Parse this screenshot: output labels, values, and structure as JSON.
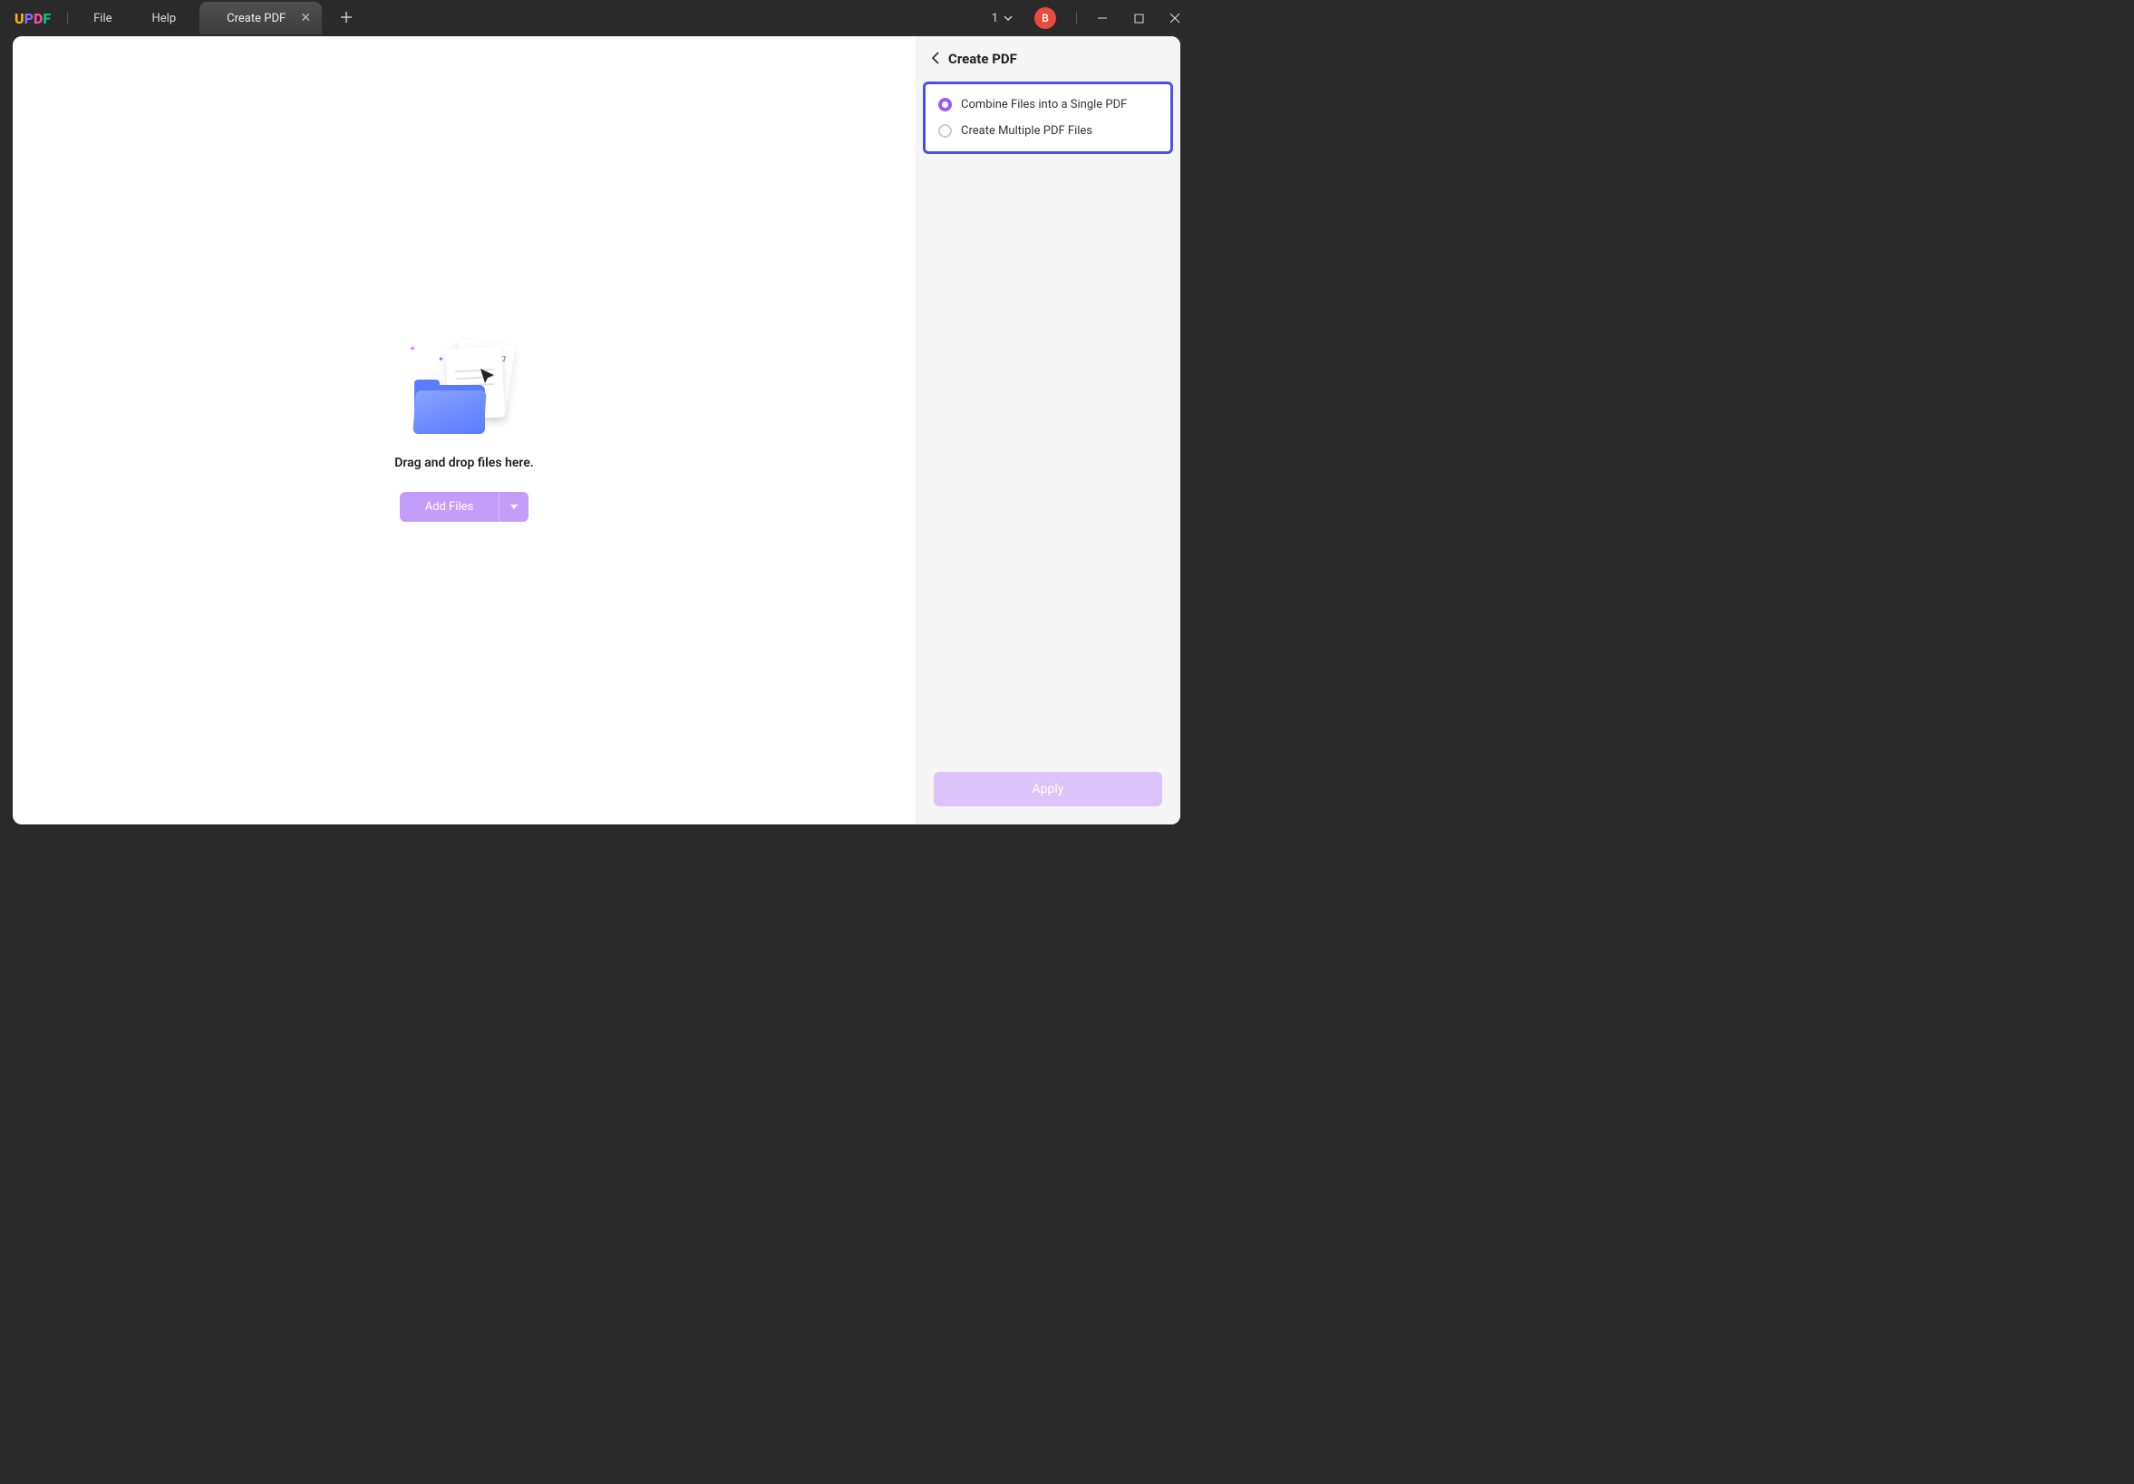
{
  "titlebar": {
    "logo_letters": [
      "U",
      "P",
      "D",
      "F"
    ],
    "menu": {
      "file": "File",
      "help": "Help"
    },
    "tab_label": "Create PDF",
    "count": "1",
    "avatar_initial": "B"
  },
  "main": {
    "drop_text": "Drag and drop files here.",
    "add_files_label": "Add Files"
  },
  "sidebar": {
    "title": "Create PDF",
    "options": [
      {
        "label": "Combine Files into a Single PDF",
        "selected": true
      },
      {
        "label": "Create Multiple PDF Files",
        "selected": false
      }
    ],
    "apply_label": "Apply"
  }
}
